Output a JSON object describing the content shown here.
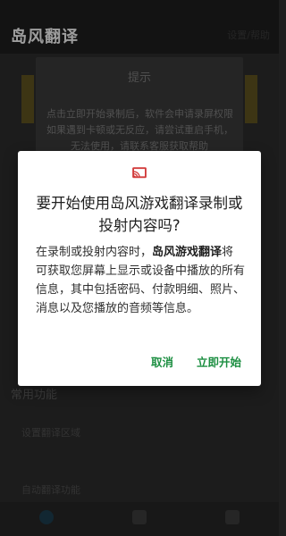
{
  "app": {
    "title": "岛风翻译",
    "top_action": "设置/帮助",
    "tip_card": {
      "title": "提示",
      "lines": [
        "点击立即开始录制后，软件会申请录屏权限",
        "如果遇到卡顿或无反应，请尝试重启手机，如果仍然",
        "无法使用，请联系客服获取帮助"
      ]
    },
    "section_title": "常用功能",
    "items": [
      "设置翻译区域",
      "自动翻译功能"
    ]
  },
  "dialog": {
    "title": "要开始使用岛风游戏翻译录制或投射内容吗?",
    "body_prefix": "在录制或投射内容时，",
    "app_name": "岛风游戏翻译",
    "body_suffix": "将可获取您屏幕上显示或设备中播放的所有信息，其中包括密码、付款明细、照片、消息以及您播放的音频等信息。",
    "cancel_label": "取消",
    "start_label": "立即开始"
  },
  "colors": {
    "accent": "#1d8f42",
    "cast_icon": "#d23c3c"
  }
}
